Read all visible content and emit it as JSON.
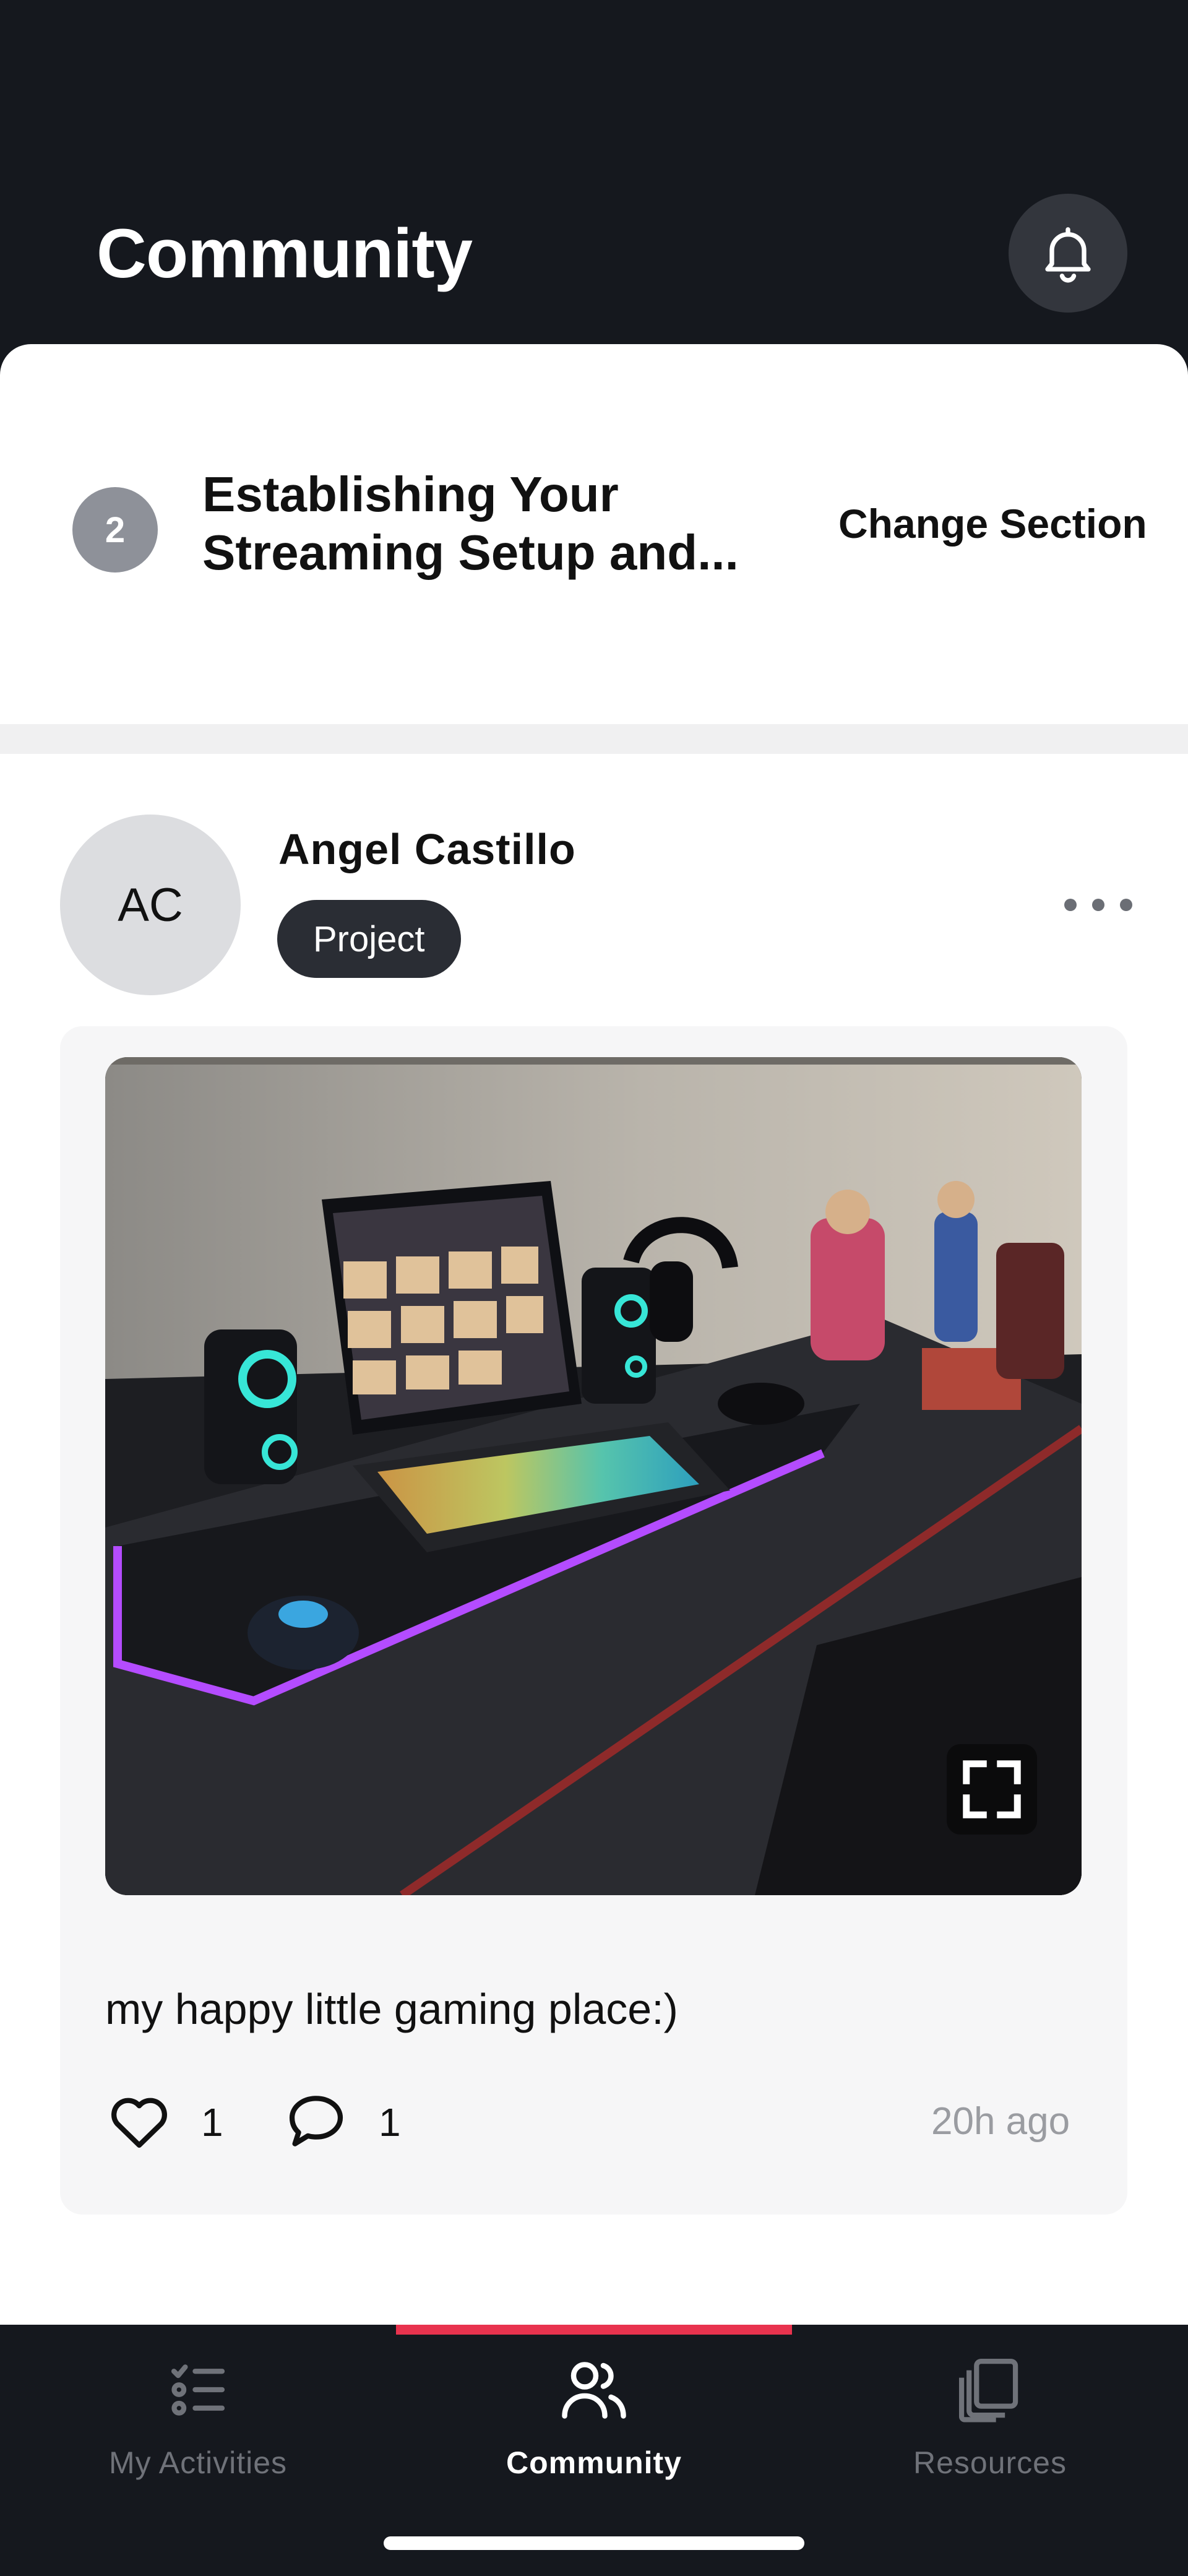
{
  "header": {
    "title": "Community",
    "bell_icon": "bell-icon"
  },
  "section": {
    "number": "2",
    "title_line1": "Establishing Your",
    "title_line2": "Streaming Setup and...",
    "change_label": "Change Section"
  },
  "post": {
    "author_initials": "AC",
    "author_name": "Angel Castillo",
    "tag": "Project",
    "more_icon": "more-horizontal-icon",
    "image_description_icon": "photo",
    "expand_icon": "fullscreen-icon",
    "text": "my happy little gaming place:)",
    "likes": "1",
    "comments": "1",
    "time": "20h ago"
  },
  "tabbar": {
    "tabs": [
      {
        "label": "My Activities",
        "icon": "checklist-icon",
        "active": false
      },
      {
        "label": "Community",
        "icon": "people-icon",
        "active": true
      },
      {
        "label": "Resources",
        "icon": "stacked-pages-icon",
        "active": false
      }
    ],
    "accent_color": "#e8334e"
  }
}
